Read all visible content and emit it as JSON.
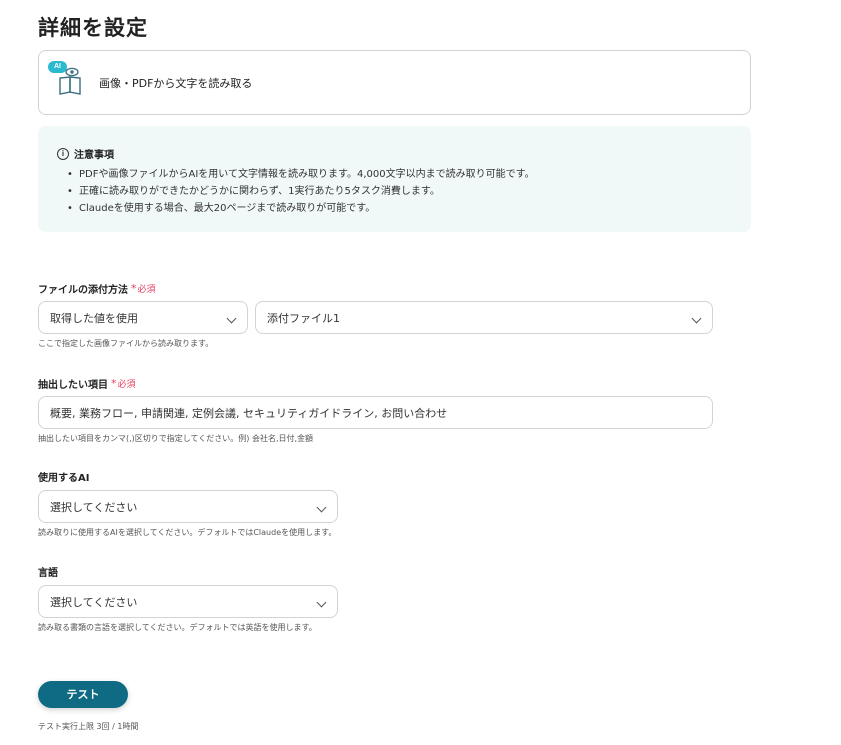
{
  "page": {
    "title": "詳細を設定"
  },
  "action": {
    "badge": "AI",
    "label": "画像・PDFから文字を読み取る"
  },
  "notice": {
    "title": "注意事項",
    "items": [
      "PDFや画像ファイルからAIを用いて文字情報を読み取ります。4,000文字以内まで読み取り可能です。",
      "正確に読み取りができたかどうかに関わらず、1実行あたり5タスク消費します。",
      "Claudeを使用する場合、最大20ページまで読み取りが可能です。"
    ]
  },
  "fields": {
    "attach_method": {
      "label": "ファイルの添付方法",
      "required": "必須",
      "select_source": "取得した値を使用",
      "select_file": "添付ファイル1",
      "hint": "ここで指定した画像ファイルから読み取ります。"
    },
    "extract_items": {
      "label": "抽出したい項目",
      "required": "必須",
      "value": "概要, 業務フロー, 申請関連, 定例会議, セキュリティガイドライン, お問い合わせ",
      "hint": "抽出したい項目をカンマ(,)区切りで指定してください。例) 会社名,日付,金額"
    },
    "ai_model": {
      "label": "使用するAI",
      "value": "選択してください",
      "hint": "読み取りに使用するAIを選択してください。デフォルトではClaudeを使用します。"
    },
    "language": {
      "label": "言語",
      "value": "選択してください",
      "hint": "読み取る書類の言語を選択してください。デフォルトでは英語を使用します。"
    }
  },
  "test": {
    "button_label": "テスト",
    "limit_text": "テスト実行上限 3回 / 1時間"
  },
  "colors": {
    "primary": "#0f6b83",
    "ai_badge": "#2bb9cf",
    "required": "#e83c5d",
    "notice_bg": "#f1f8f8"
  }
}
